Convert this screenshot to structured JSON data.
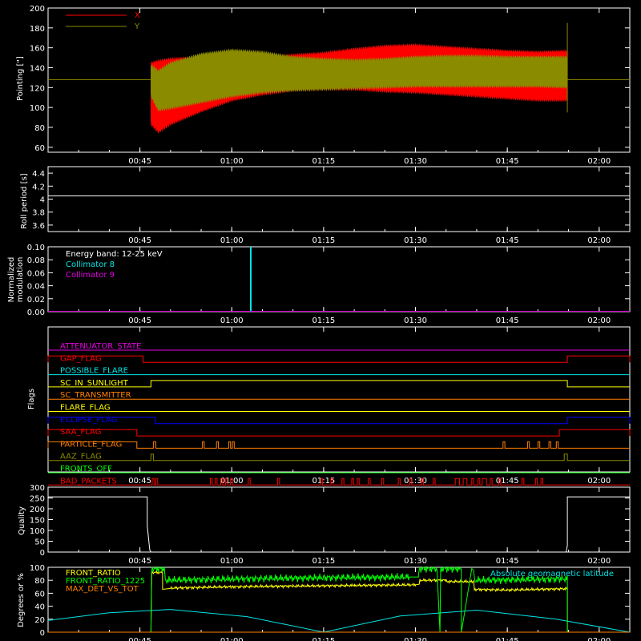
{
  "colors": {
    "background": "#000000",
    "axes": "#ffffff",
    "red": "#ff0000",
    "olive": "#8b8b00",
    "cyan": "#00e5e5",
    "magenta": "#e600e6",
    "orange": "#ff7f00",
    "yellow": "#ffff00",
    "blue": "#0000ff",
    "green": "#00ff00"
  },
  "time_axis": {
    "range_minutes": [
      30,
      125
    ],
    "tick_minutes": [
      45,
      60,
      75,
      90,
      105,
      120
    ],
    "tick_labels": [
      "00:45",
      "01:00",
      "01:15",
      "01:30",
      "01:45",
      "02:00"
    ]
  },
  "chart_data": [
    {
      "id": "pointing",
      "type": "area",
      "ylabel": "Pointing [\"]",
      "ylim": [
        55,
        200
      ],
      "yticks": [
        60,
        80,
        100,
        120,
        140,
        160,
        180,
        200
      ],
      "legend": [
        {
          "label": "X",
          "color": "red"
        },
        {
          "label": "Y",
          "color": "olive"
        }
      ],
      "data_start_min": 46.8,
      "data_end_min": 114.8,
      "baseline": 128,
      "series": [
        {
          "name": "X",
          "color": "red",
          "envelope_min": [
            46.8,
            48,
            50,
            55,
            60,
            65,
            70,
            75,
            80,
            85,
            90,
            95,
            100,
            105,
            110,
            114.8
          ],
          "envelope_upper": [
            146,
            148,
            150,
            152,
            152,
            152,
            154,
            156,
            160,
            163,
            164,
            162,
            160,
            158,
            157,
            158
          ],
          "envelope_lower": [
            82,
            74,
            82,
            95,
            106,
            112,
            116,
            117,
            117,
            115,
            114,
            112,
            110,
            108,
            106,
            106
          ]
        },
        {
          "name": "Y",
          "color": "olive",
          "envelope_min": [
            46.8,
            48,
            50,
            55,
            60,
            65,
            70,
            75,
            80,
            85,
            90,
            95,
            100,
            105,
            110,
            114.8
          ],
          "envelope_upper": [
            144,
            138,
            146,
            155,
            159,
            157,
            152,
            150,
            149,
            150,
            152,
            153,
            153,
            152,
            152,
            152
          ],
          "envelope_lower": [
            110,
            96,
            98,
            104,
            110,
            114,
            116,
            117,
            118,
            119,
            120,
            120,
            120,
            120,
            120,
            119
          ]
        }
      ]
    },
    {
      "id": "roll",
      "type": "line",
      "ylabel": "Roll period [s]",
      "ylim": [
        3.5,
        4.5
      ],
      "yticks": [
        3.6,
        3.8,
        4.0,
        4.2,
        4.4
      ],
      "series": [
        {
          "name": "",
          "color": "axes",
          "x": [
            30,
            125
          ],
          "y": [
            4.05,
            4.05
          ]
        }
      ]
    },
    {
      "id": "modulation",
      "type": "line",
      "ylabel_lines": [
        "Normalized",
        "modulation"
      ],
      "ylim": [
        0,
        0.1
      ],
      "yticks": [
        0.0,
        0.02,
        0.04,
        0.06,
        0.08,
        0.1
      ],
      "ytick_labels": [
        "0.00",
        "0.02",
        "0.04",
        "0.06",
        "0.08",
        "0.10"
      ],
      "annotations": [
        {
          "text": "Energy band: 12-25 keV",
          "color": "axes"
        },
        {
          "text": "Collimator 8",
          "color": "cyan"
        },
        {
          "text": "Collimator 9",
          "color": "magenta"
        }
      ],
      "series": [
        {
          "name": "Collimator 8",
          "color": "cyan",
          "x": [
            63.1,
            63.1
          ],
          "y": [
            0,
            0.1
          ]
        },
        {
          "name": "Collimator 9",
          "color": "magenta",
          "x": [
            30,
            125
          ],
          "y": [
            0.0005,
            0.0005
          ]
        }
      ]
    },
    {
      "id": "flags",
      "type": "line",
      "ylabel": "Flags",
      "flags": [
        {
          "label": "ATTENUATOR_STATE",
          "color": "magenta",
          "high": []
        },
        {
          "label": "GAP_FLAG",
          "color": "red",
          "high": [
            [
              30,
              45.5
            ],
            [
              114.8,
              125
            ]
          ]
        },
        {
          "label": "POSSIBLE_FLARE",
          "color": "cyan",
          "high": []
        },
        {
          "label": "SC_IN_SUNLIGHT",
          "color": "yellow",
          "high": [
            [
              46.8,
              114.8
            ]
          ]
        },
        {
          "label": "SC_TRANSMITTER",
          "color": "orange",
          "high": []
        },
        {
          "label": "FLARE_FLAG",
          "color": "yellow",
          "high": []
        },
        {
          "label": "ECLIPSE_FLAG",
          "color": "blue",
          "high": [
            [
              30,
              47.5
            ],
            [
              114.8,
              125
            ]
          ]
        },
        {
          "label": "SAA_FLAG",
          "color": "red",
          "high": [
            [
              30,
              44.5
            ],
            [
              113.5,
              125
            ]
          ]
        },
        {
          "label": "PARTICLE_FLAG",
          "color": "orange",
          "high": [
            [
              30,
              44.5
            ],
            [
              47.2,
              47.6
            ],
            [
              55.2,
              55.5
            ],
            [
              57.5,
              57.8
            ],
            [
              59.5,
              59.8
            ],
            [
              60.1,
              60.4
            ],
            [
              104.3,
              104.6
            ],
            [
              108.3,
              108.6
            ],
            [
              110,
              110.3
            ],
            [
              111.8,
              112.1
            ],
            [
              113,
              113.3
            ]
          ]
        },
        {
          "label": "AAZ_FLAG",
          "color": "olive",
          "high": [
            [
              46.8,
              47.2
            ],
            [
              114.3,
              114.8
            ]
          ]
        },
        {
          "label": "FRONTS_OFF",
          "color": "green",
          "high": []
        },
        {
          "label": "BAD_PACKETS",
          "color": "red",
          "high": [
            [
              47,
              47.3
            ],
            [
              47.6,
              47.9
            ],
            [
              56.5,
              56.8
            ],
            [
              57.3,
              57.6
            ],
            [
              58.2,
              58.5
            ],
            [
              59,
              59.3
            ],
            [
              59.8,
              60.1
            ],
            [
              62.7,
              63
            ],
            [
              67.5,
              67.8
            ],
            [
              74.5,
              74.8
            ],
            [
              76.2,
              76.5
            ],
            [
              78,
              78.3
            ],
            [
              79.6,
              79.9
            ],
            [
              80.5,
              80.8
            ],
            [
              82.3,
              82.6
            ],
            [
              84.5,
              84.8
            ],
            [
              87.2,
              87.5
            ],
            [
              89.1,
              89.4
            ],
            [
              91,
              91.3
            ],
            [
              92.9,
              93.2
            ],
            [
              96.5,
              97.2
            ],
            [
              97.8,
              98.4
            ],
            [
              99.2,
              99.5
            ],
            [
              100.2,
              100.5
            ],
            [
              100.9,
              101.6
            ],
            [
              102.2,
              102.5
            ],
            [
              103.6,
              103.9
            ],
            [
              107.4,
              107.7
            ],
            [
              109.6,
              109.9
            ],
            [
              110.5,
              110.8
            ]
          ]
        }
      ]
    },
    {
      "id": "quality",
      "type": "line",
      "ylabel": "Quality",
      "ylim": [
        0,
        300
      ],
      "yticks": [
        0,
        50,
        100,
        150,
        200,
        250,
        300
      ],
      "series": [
        {
          "name": "",
          "color": "axes",
          "x": [
            30,
            46.2,
            46.2,
            46.6,
            46.8,
            114.6,
            114.8,
            114.8,
            125
          ],
          "y": [
            255,
            255,
            120,
            10,
            0,
            0,
            30,
            255,
            255
          ]
        }
      ]
    },
    {
      "id": "ratios",
      "type": "line",
      "ylabel": "Degrees or %",
      "ylim": [
        0,
        100
      ],
      "yticks": [
        0,
        20,
        40,
        60,
        80,
        100
      ],
      "legend": [
        {
          "label": "FRONT_RATIO",
          "color": "yellow"
        },
        {
          "label": "FRONT_RATIO_1225",
          "color": "green"
        },
        {
          "label": "MAX_DET_VS_TOT",
          "color": "orange"
        }
      ],
      "annotation": {
        "text": "Absolute geomagnetic latitude",
        "color": "cyan"
      },
      "latitude": {
        "x": [
          30,
          40,
          50,
          62.5,
          75,
          87.5,
          100,
          113,
          125
        ],
        "y": [
          18,
          30,
          35,
          24,
          0,
          25,
          34,
          20,
          0
        ]
      },
      "front_ratio": {
        "x": [
          30,
          46.8,
          46.8,
          48.7,
          48.7,
          50,
          60,
          70,
          80,
          90,
          90.6,
          90.6,
          95,
          95,
          99.5,
          99.5,
          105,
          114.8,
          114.8,
          125
        ],
        "y": [
          0,
          0,
          92,
          92,
          66,
          68,
          70,
          71,
          72,
          73,
          74,
          80,
          80,
          78,
          78,
          66,
          65,
          67,
          0,
          0
        ]
      },
      "front_ratio_1225": {
        "x": [
          30,
          46.8,
          46.8,
          49,
          49,
          60,
          75,
          89,
          90.5,
          90.5,
          93.5,
          94,
          94,
          97.5,
          97.5,
          99.2,
          99.5,
          99.5,
          114.8,
          114.8,
          125
        ],
        "y": [
          0,
          0,
          98,
          98,
          80,
          82,
          84,
          85,
          85,
          98,
          98,
          0,
          98,
          98,
          0,
          98,
          95,
          80,
          82,
          0,
          0
        ]
      },
      "max_det": {
        "x": [
          30,
          125
        ],
        "y": [
          0,
          0
        ]
      }
    }
  ]
}
